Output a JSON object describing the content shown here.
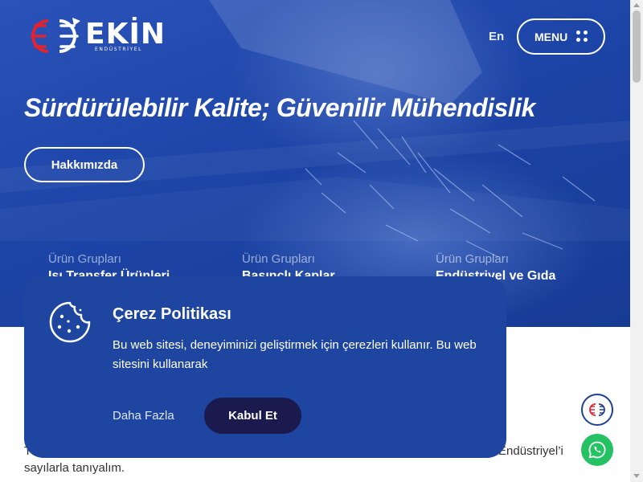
{
  "brand": {
    "name": "EKİN",
    "subtitle": "ENDÜSTRİYEL"
  },
  "header": {
    "lang_label": "En",
    "menu_label": "MENU"
  },
  "hero": {
    "headline": "Sürdürülebilir Kalite; Güvenilir Mühendislik",
    "about_button": "Hakkımızda"
  },
  "product_groups": [
    {
      "label": "Ürün Grupları",
      "title": "Isı Transfer Ürünleri"
    },
    {
      "label": "Ürün Grupları",
      "title": "Basınçlı Kaplar"
    },
    {
      "label": "Ürün Grupları",
      "title": "Endüstriyel ve Gıda"
    }
  ],
  "intro": {
    "prefix": "T",
    "right_text": "Endüstriyel’i",
    "line2": "sayılarla tanıyalım."
  },
  "cookie": {
    "title": "Çerez Politikası",
    "text": "Bu web sitesi, deneyiminizi geliştirmek için çerezleri kullanır. Bu web sitesini kullanarak",
    "more_label": "Daha Fazla",
    "accept_label": "Kabul Et"
  },
  "icons": {
    "cookie": "cookie-icon",
    "menu": "grid-dots-icon",
    "whatsapp": "whatsapp-icon",
    "logo_badge": "ekin-logo-icon"
  },
  "colors": {
    "hero_blue": "#1d45a8",
    "cookie_blue": "#1e46a1",
    "accept_dark": "#1b1a4e",
    "logo_red": "#e4232e",
    "whatsapp_green": "#25c263"
  }
}
